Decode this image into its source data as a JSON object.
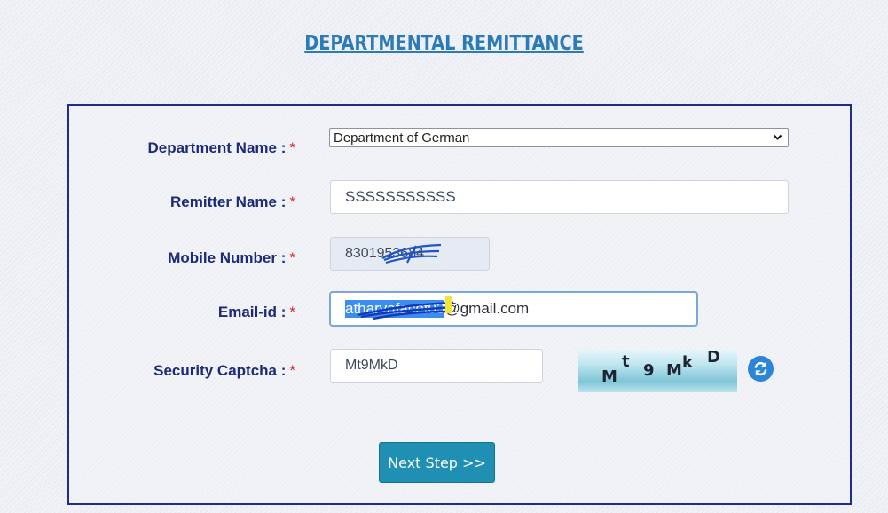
{
  "page": {
    "title": "DEPARTMENTAL REMITTANCE"
  },
  "form": {
    "required_marker": "*",
    "department": {
      "label": "Department Name :",
      "value": "Department of German",
      "chevron_icon": "chevron-down-icon"
    },
    "remitter": {
      "label": "Remitter Name :",
      "value": "SSSSSSSSSSS"
    },
    "mobile": {
      "label": "Mobile Number :",
      "value": "8301953684"
    },
    "email": {
      "label": "Email-id :",
      "value_selected": "atharvafacet03",
      "value_suffix": "@gmail.com"
    },
    "captcha": {
      "label": "Security Captcha :",
      "value": "Mt9MkD",
      "image_text": "Mt9MkD",
      "refresh_icon": "refresh-icon"
    },
    "next_button": {
      "label": "Next Step >>"
    }
  },
  "colors": {
    "title": "#2b7bb9",
    "label": "#1c2a78",
    "required_star": "#e0232b",
    "panel_border": "#1f2d8a",
    "button_bg": "#1f8fb4",
    "selection": "#3b8ef0"
  }
}
